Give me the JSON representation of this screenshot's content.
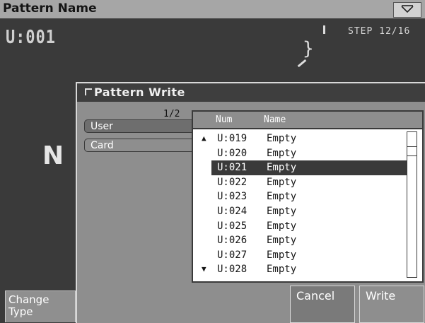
{
  "header": {
    "title": "Pattern Name"
  },
  "pattern": {
    "number": "U:001",
    "step": "STEP 12/16",
    "name_partial": "N"
  },
  "footer": {
    "change_type_line1": "Change",
    "change_type_line2": "Type"
  },
  "dialog": {
    "title": "Pattern Write",
    "page_indicator": "1/2",
    "sources": [
      "User",
      "Card"
    ],
    "selected_source": "User",
    "list": {
      "headers": {
        "num": "Num",
        "name": "Name"
      },
      "rows": [
        {
          "num": "U:019",
          "name": "Empty",
          "arrow": "up"
        },
        {
          "num": "U:020",
          "name": "Empty"
        },
        {
          "num": "U:021",
          "name": "Empty",
          "selected": true
        },
        {
          "num": "U:022",
          "name": "Empty"
        },
        {
          "num": "U:023",
          "name": "Empty"
        },
        {
          "num": "U:024",
          "name": "Empty"
        },
        {
          "num": "U:025",
          "name": "Empty"
        },
        {
          "num": "U:026",
          "name": "Empty"
        },
        {
          "num": "U:027",
          "name": "Empty"
        },
        {
          "num": "U:028",
          "name": "Empty",
          "arrow": "down"
        }
      ]
    },
    "buttons": {
      "cancel": "Cancel",
      "write": "Write"
    }
  },
  "colors": {
    "background": "#3a3a3a",
    "titlebar": "#a6a6a6",
    "dialog": "#8e8e8e",
    "selection": "#3a3a3a"
  }
}
